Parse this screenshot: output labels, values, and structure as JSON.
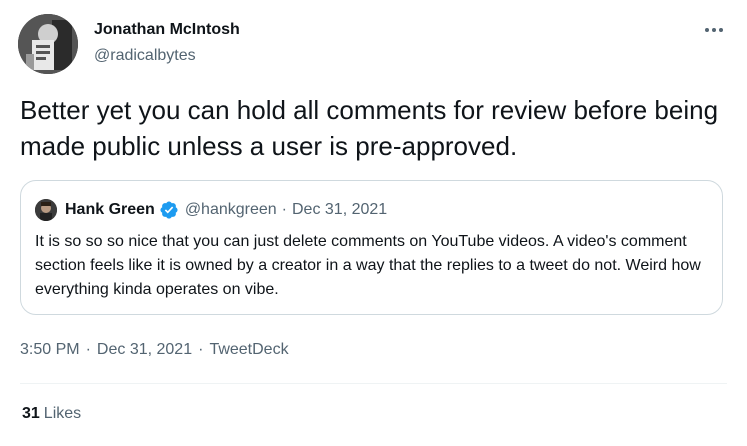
{
  "author": {
    "name": "Jonathan McIntosh",
    "handle": "@radicalbytes"
  },
  "tweet": {
    "text": "Better yet you can hold all comments for review before being made public unless a user is pre-approved."
  },
  "quoted_tweet": {
    "author_name": "Hank Green",
    "author_handle": "@hankgreen",
    "separator": "·",
    "date": "Dec 31, 2021",
    "text": "It is so so so nice that you can just delete comments on YouTube videos. A video's comment section feels like it is owned by a creator in a way that the replies to a tweet  do not. Weird how everything kinda operates on vibe."
  },
  "meta": {
    "time": "3:50 PM",
    "separator": "·",
    "date": "Dec 31, 2021",
    "source": "TweetDeck"
  },
  "stats": {
    "likes_count": "31",
    "likes_label": "Likes"
  },
  "colors": {
    "text_primary": "#0f1419",
    "text_secondary": "#536471",
    "border": "#cfd9de",
    "verified": "#1d9bf0"
  },
  "icons": {
    "more": "more-icon",
    "verified": "verified-badge-icon"
  }
}
